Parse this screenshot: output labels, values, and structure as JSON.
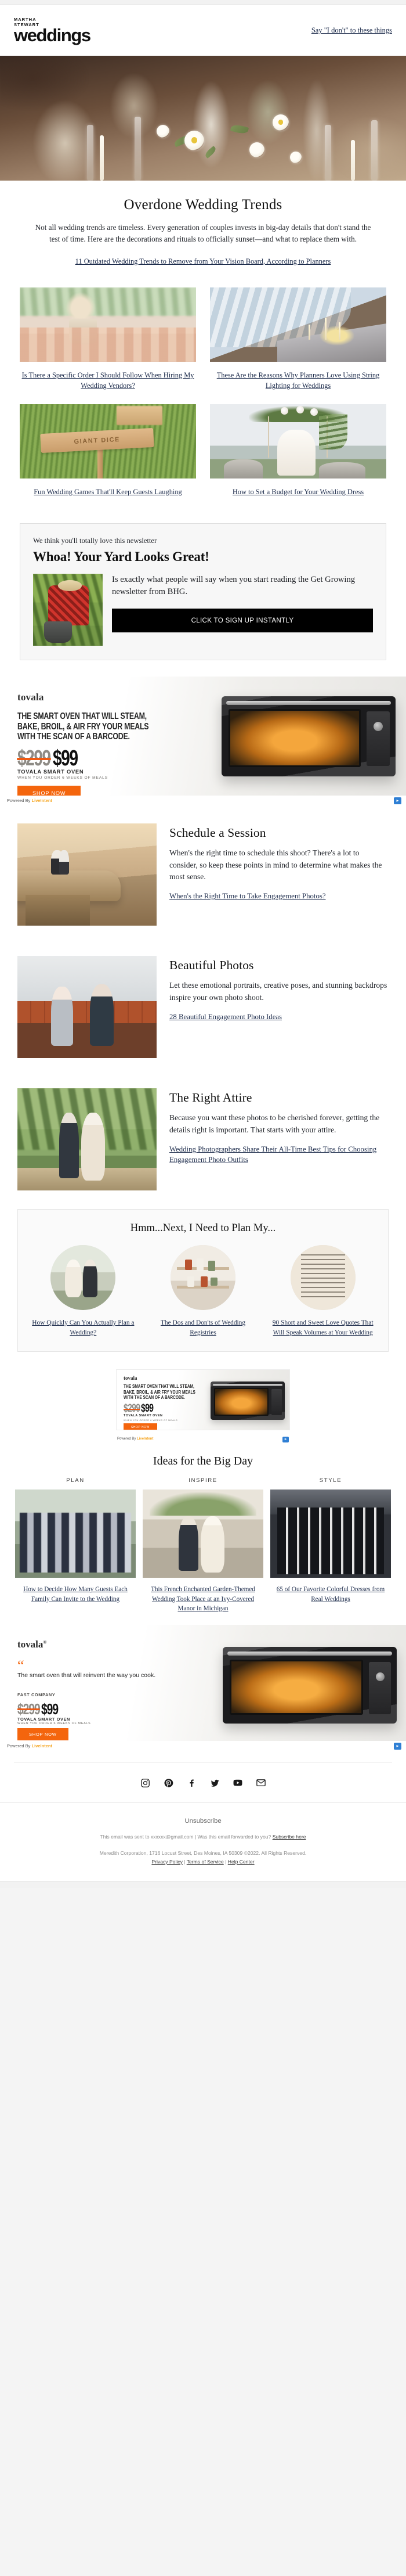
{
  "header": {
    "logo_kicker_line1": "MARTHA",
    "logo_kicker_line2": "STEWART",
    "logo_word": "weddings",
    "preheader_link": "Say \"I don't\" to these things"
  },
  "intro": {
    "title": "Overdone Wedding Trends",
    "body": "Not all wedding trends are timeless. Every generation of couples invests in big-day details that don't stand the test of time. Here are the decorations and rituals to officially sunset—and what to replace them with.",
    "lead_link": "11 Outdated Wedding Trends to Remove from Your Vision Board, According to Planners"
  },
  "grid": [
    {
      "image_name": "pampas-grass-reception-tablescape",
      "caption": "Is There a Specific Order I Should Follow When Hiring My Wedding Vendors?"
    },
    {
      "image_name": "greenhouse-string-lighting-dinner",
      "caption": "These Are the Reasons Why Planners Love Using String Lighting for Weddings"
    },
    {
      "image_name": "giant-dice-lawn-game-sign",
      "caption": "Fun Wedding Games That'll Keep Guests Laughing"
    },
    {
      "image_name": "bride-on-floral-swing-by-the-sea",
      "caption": "How to Set a Budget for Your Wedding Dress"
    }
  ],
  "promo": {
    "eyebrow": "We think you'll totally love this newsletter",
    "title": "Whoa! Your Yard Looks Great!",
    "image_name": "woman-gardening-in-plaid-shirt",
    "body": "Is exactly what people will say when you start reading the Get Growing newsletter from BHG.",
    "cta": "CLICK TO SIGN UP INSTANTLY"
  },
  "ad_large": {
    "brand": "tovala",
    "headline": "THE SMART OVEN THAT WILL STEAM, BAKE, BROIL, & AIR FRY YOUR MEALS WITH THE SCAN OF A BARCODE.",
    "price_old": "$299",
    "price_new": "$99",
    "product": "TOVALA SMART OVEN",
    "condition": "WHEN YOU ORDER 6 WEEKS OF MEALS",
    "cta": "SHOP NOW",
    "powered_by": "Powered By",
    "powered_brand": "LiveIntent",
    "adchoices": "AdChoices"
  },
  "features": [
    {
      "image_name": "couple-on-desert-cliff-at-sunset",
      "title": "Schedule a Session",
      "body": "When's the right time to schedule this shoot? There's a lot to consider, so keep these points in mind to determine what makes the most sense.",
      "link": "When's the Right Time to Take Engagement Photos?"
    },
    {
      "image_name": "couple-in-front-of-brick-wall",
      "title": "Beautiful Photos",
      "body": "Let these emotional portraits, creative poses, and stunning backdrops inspire your own photo shoot.",
      "link": "28 Beautiful Engagement Photo Ideas"
    },
    {
      "image_name": "couple-walking-outdoors-holding-hands",
      "title": "The Right Attire",
      "body": "Because you want these photos to be cherished forever, getting the details right is important. That starts with your attire.",
      "link": "Wedding Photographers Share Their All-Time Best Tips for Choosing Engagement Photo Outfits"
    }
  ],
  "next_section": {
    "title": "Hmm...Next, I Need to Plan My...",
    "items": [
      {
        "image_name": "couple-planning-wedding-outdoors",
        "link": "How Quickly Can You Actually Plan a Wedding?"
      },
      {
        "image_name": "wedding-registry-shelf-display",
        "link": "The Dos and Don'ts of Wedding Registries"
      },
      {
        "image_name": "handwritten-love-quote-page",
        "link": "90 Short and Sweet Love Quotes That Will Speak Volumes at Your Wedding"
      }
    ]
  },
  "ad_small": {
    "brand": "tovala",
    "headline": "THE SMART OVEN THAT WILL STEAM, BAKE, BROIL, & AIR FRY YOUR MEALS WITH THE SCAN OF A BARCODE.",
    "price_old": "$299",
    "price_new": "$99",
    "product": "TOVALA SMART OVEN",
    "condition": "WHEN YOU ORDER 6 WEEKS OF MEALS",
    "cta": "SHOP NOW",
    "powered_by": "Powered By",
    "powered_brand": "LiveIntent",
    "adchoices": "AdChoices"
  },
  "ideas": {
    "title": "Ideas for the Big Day",
    "columns": [
      {
        "label": "PLAN",
        "image_name": "wedding-party-group-photo",
        "link": "How to Decide How Many Guests Each Family Can Invite to the Wedding"
      },
      {
        "label": "INSPIRE",
        "image_name": "garden-themed-wedding-ceremony",
        "link": "This French Enchanted Garden-Themed Wedding Took Place at an Ivy-Covered Manor in Michigan"
      },
      {
        "label": "STYLE",
        "image_name": "groomsmen-in-colorful-tuxedos",
        "link": "65 of Our Favorite Colorful Dresses from Real Weddings"
      }
    ]
  },
  "ad_quote": {
    "brand": "tovala",
    "brand_sup": "®",
    "quote_mark": "“",
    "quote": "The smart oven that will reinvent the way you cook.",
    "source": "FAST COMPANY",
    "price_old": "$299",
    "price_new": "$99",
    "product": "TOVALA SMART OVEN",
    "condition": "WHEN YOU ORDER 6 WEEKS OF MEALS",
    "cta": "SHOP NOW",
    "powered_by": "Powered By",
    "powered_brand": "LiveIntent",
    "adchoices": "AdChoices"
  },
  "social": [
    {
      "name": "instagram",
      "label": "Instagram"
    },
    {
      "name": "pinterest",
      "label": "Pinterest"
    },
    {
      "name": "facebook",
      "label": "Facebook"
    },
    {
      "name": "twitter",
      "label": "Twitter"
    },
    {
      "name": "youtube",
      "label": "YouTube"
    },
    {
      "name": "email",
      "label": "Email"
    }
  ],
  "footer": {
    "unsubscribe": "Unsubscribe",
    "sent_to_prefix": "This email was sent to xxxxxx@gmail.com  |  Was this email forwarded to you?",
    "subscribe_link": "Subscribe here",
    "legal": "Meredith Corporation, 1716 Locust Street, Des Moines, IA 50309 ©2022. All Rights Reserved.",
    "privacy": "Privacy Policy",
    "terms": "Terms of Service",
    "help": "Help Center",
    "sep": "|"
  }
}
